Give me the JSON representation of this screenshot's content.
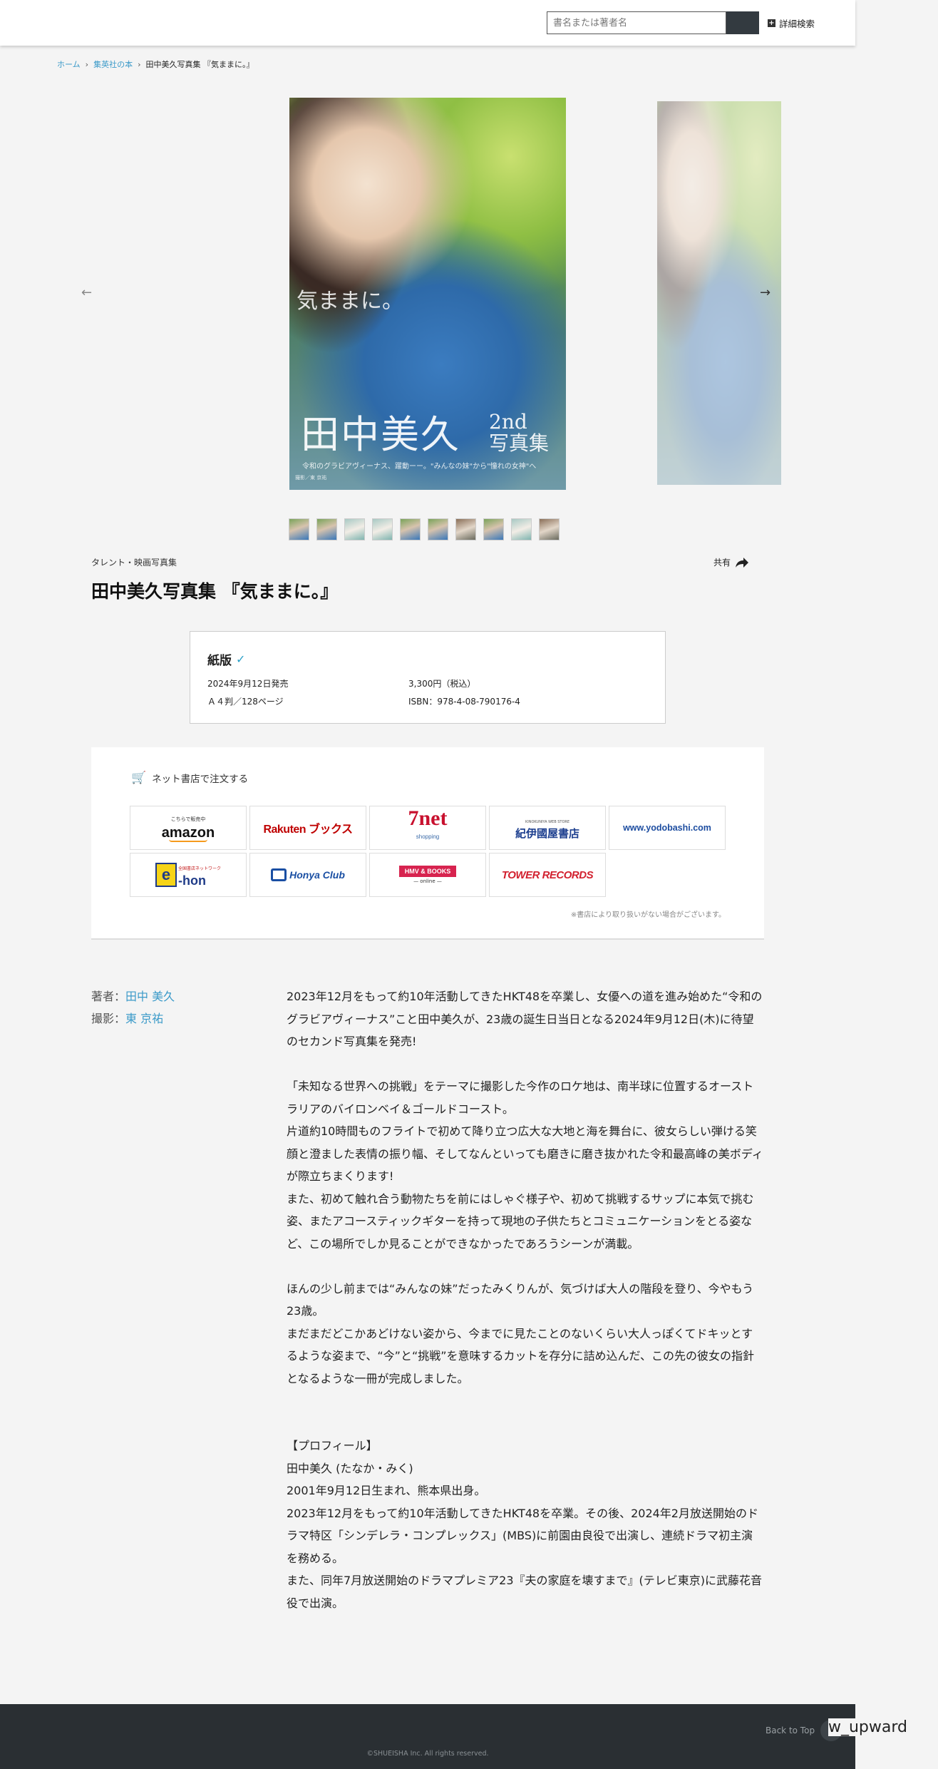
{
  "header": {
    "search_placeholder": "書名または著者名",
    "advanced_search_label": "詳細検索"
  },
  "breadcrumb": {
    "home": "ホーム",
    "books": "集英社の本",
    "current": "田中美久写真集 『気ままに。』"
  },
  "carousel": {
    "cover_title": "田中美久",
    "cover_sub_line1": "2nd",
    "cover_sub_line2": "写真集",
    "cover_script": "気ままに。",
    "cover_tagline": "令和のグラビアヴィーナス、躍動ーー。\"みんなの妹\"から\"憧れの女神\"へ",
    "cover_credit": "撮影／東 京祐",
    "prev_arrow": "←",
    "next_arrow": "→",
    "thumbnail_count": 10
  },
  "book": {
    "category": "タレント・映画写真集",
    "share_label": "共有",
    "title": "田中美久写真集 『気ままに。』"
  },
  "edition": {
    "name": "紙版",
    "release_date": "2024年9月12日発売",
    "format": "Ａ４判／128ページ",
    "price": "3,300円（税込）",
    "isbn": "ISBN：978-4-08-790176-4"
  },
  "stores": {
    "heading": "ネット書店で注文する",
    "note": "※書店により取り扱いがない場合がございます。",
    "amazon_small": "こちらで販売中",
    "amazon": "amazon",
    "rakuten": "Rakuten ブックス",
    "sevennet": "7net",
    "sevennet_small": "shopping",
    "kinokuniya_small": "KINOKUNIYA WEB STORE",
    "kinokuniya": "紀伊國屋書店",
    "yodobashi": "www.yodobashi.com",
    "ehon_small": "全国書店ネットワーク",
    "ehon_badge": "e",
    "ehon": "-hon",
    "honya": "Honya Club",
    "hmv": "HMV & BOOKS",
    "hmv_sub": "— online —",
    "tower": "TOWER RECORDS"
  },
  "credits": {
    "author_label": "著者：",
    "author_name": "田中 美久",
    "photo_label": "撮影：",
    "photo_name": "東 京祐"
  },
  "description": {
    "p1": "2023年12月をもって約10年活動してきたHKT48を卒業し、女優への道を進み始めた“令和のグラビアヴィーナス”こと田中美久が、23歳の誕生日当日となる2024年9月12日(木)に待望のセカンド写真集を発売!",
    "p2": "「未知なる世界への挑戦」をテーマに撮影した今作のロケ地は、南半球に位置するオーストラリアのバイロンベイ＆ゴールドコースト。",
    "p3": "片道約10時間ものフライトで初めて降り立つ広大な大地と海を舞台に、彼女らしい弾ける笑顔と澄ました表情の振り幅、そしてなんといっても磨きに磨き抜かれた令和最高峰の美ボディが際立ちまくります!",
    "p4": "また、初めて触れ合う動物たちを前にはしゃぐ様子や、初めて挑戦するサップに本気で挑む姿、またアコースティックギターを持って現地の子供たちとコミュニケーションをとる姿など、この場所でしか見ることができなかったであろうシーンが満載。",
    "p5": "ほんの少し前までは“みんなの妹”だったみくりんが、気づけば大人の階段を登り、今やもう23歳。",
    "p6": "まだまだどこかあどけない姿から、今までに見たことのないくらい大人っぽくてドキッとするような姿まで、“今”と“挑戦”を意味するカットを存分に詰め込んだ、この先の彼女の指針となるような一冊が完成しました。",
    "p7": "【プロフィール】",
    "p8": "田中美久 (たなか・みく)",
    "p9": "2001年9月12日生まれ、熊本県出身。",
    "p10": "2023年12月をもって約10年活動してきたHKT48を卒業。その後、2024年2月放送開始のドラマ特区「シンデレラ・コンプレックス」(MBS)に前園由良役で出演し、連続ドラマ初主演を務める。",
    "p11": "また、同年7月放送開始のドラマプレミア23『夫の家庭を壊すまで』(テレビ東京)に武藤花音役で出演。"
  },
  "footer": {
    "back_to_top": "Back to Top",
    "icon_text": "w_upward",
    "copyright": "©SHUEISHA Inc. All rights reserved."
  }
}
